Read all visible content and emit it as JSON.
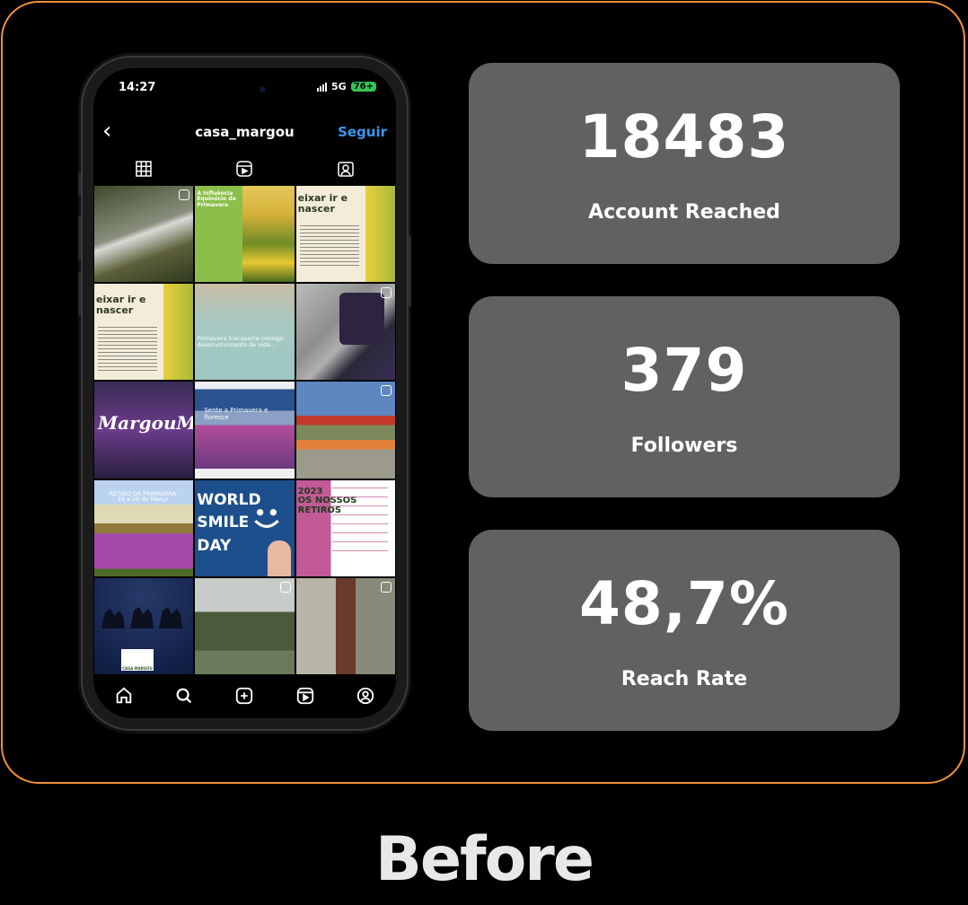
{
  "phone": {
    "status_time": "14:27",
    "status_network": "5G",
    "status_battery": "76+",
    "profile_username": "casa_margou",
    "follow_label": "Seguir",
    "tiles": [
      {
        "caption": "",
        "reel": true
      },
      {
        "caption": "A Influência\nEquinócio da\nPrimavera",
        "reel": false
      },
      {
        "caption": "eixar ir e\nnascer",
        "reel": false
      },
      {
        "caption": "eixar ir e\nnascer",
        "reel": false
      },
      {
        "caption": "Primavera transporta consigo\ndesenvolvimento de vida...",
        "reel": false
      },
      {
        "caption": "",
        "reel": true
      },
      {
        "caption": "MargouM",
        "reel": false
      },
      {
        "caption": "Sente a Primavera e floresce",
        "reel": false
      },
      {
        "caption": "",
        "reel": true
      },
      {
        "caption": "RETIRO DA PRIMAVERA\n24 a 26 de Março",
        "reel": false
      },
      {
        "caption": "WORLD\nSMILE\nDAY",
        "reel": false
      },
      {
        "caption": "2023\nOS NOSSOS\nRETIROS",
        "reel": false
      },
      {
        "caption": "CASA MARGOU",
        "reel": false
      },
      {
        "caption": "",
        "reel": true
      },
      {
        "caption": "",
        "reel": true
      }
    ]
  },
  "stats": [
    {
      "value": "18483",
      "label": "Account Reached"
    },
    {
      "value": "379",
      "label": "Followers"
    },
    {
      "value": "48,7%",
      "label": "Reach Rate"
    }
  ],
  "footer_label": "Before",
  "colors": {
    "frame_border": "#f0903a",
    "card_bg": "#616161",
    "follow_blue": "#3897f0"
  }
}
